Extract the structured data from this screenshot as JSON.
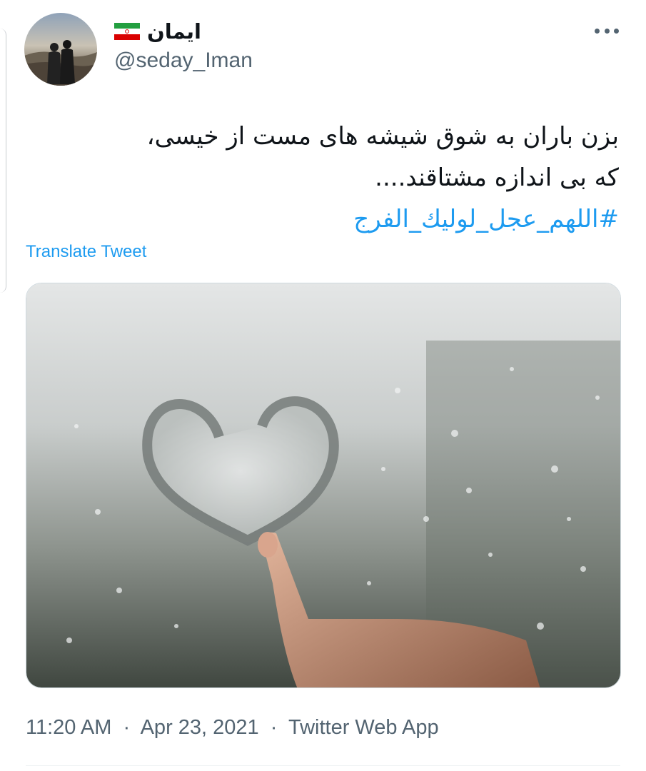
{
  "author": {
    "display_name": "ایمان",
    "handle": "@seday_Iman"
  },
  "tweet": {
    "lines": [
      "بزن باران به شوق شیشه های مست از خیسی،",
      "که بی اندازه مشتاقند...."
    ],
    "hashtag": "#اللهم_عجل_لوليك_الفرج",
    "translate_label": "Translate Tweet"
  },
  "meta": {
    "time": "11:20 AM",
    "date": "Apr 23, 2021",
    "source": "Twitter Web App",
    "separator": "·"
  },
  "icons": {
    "avatar": "avatar-photo",
    "flag": "iran-flag-icon",
    "more": "more-options-icon"
  },
  "colors": {
    "link": "#1d9bf0",
    "secondary_text": "#536471"
  }
}
